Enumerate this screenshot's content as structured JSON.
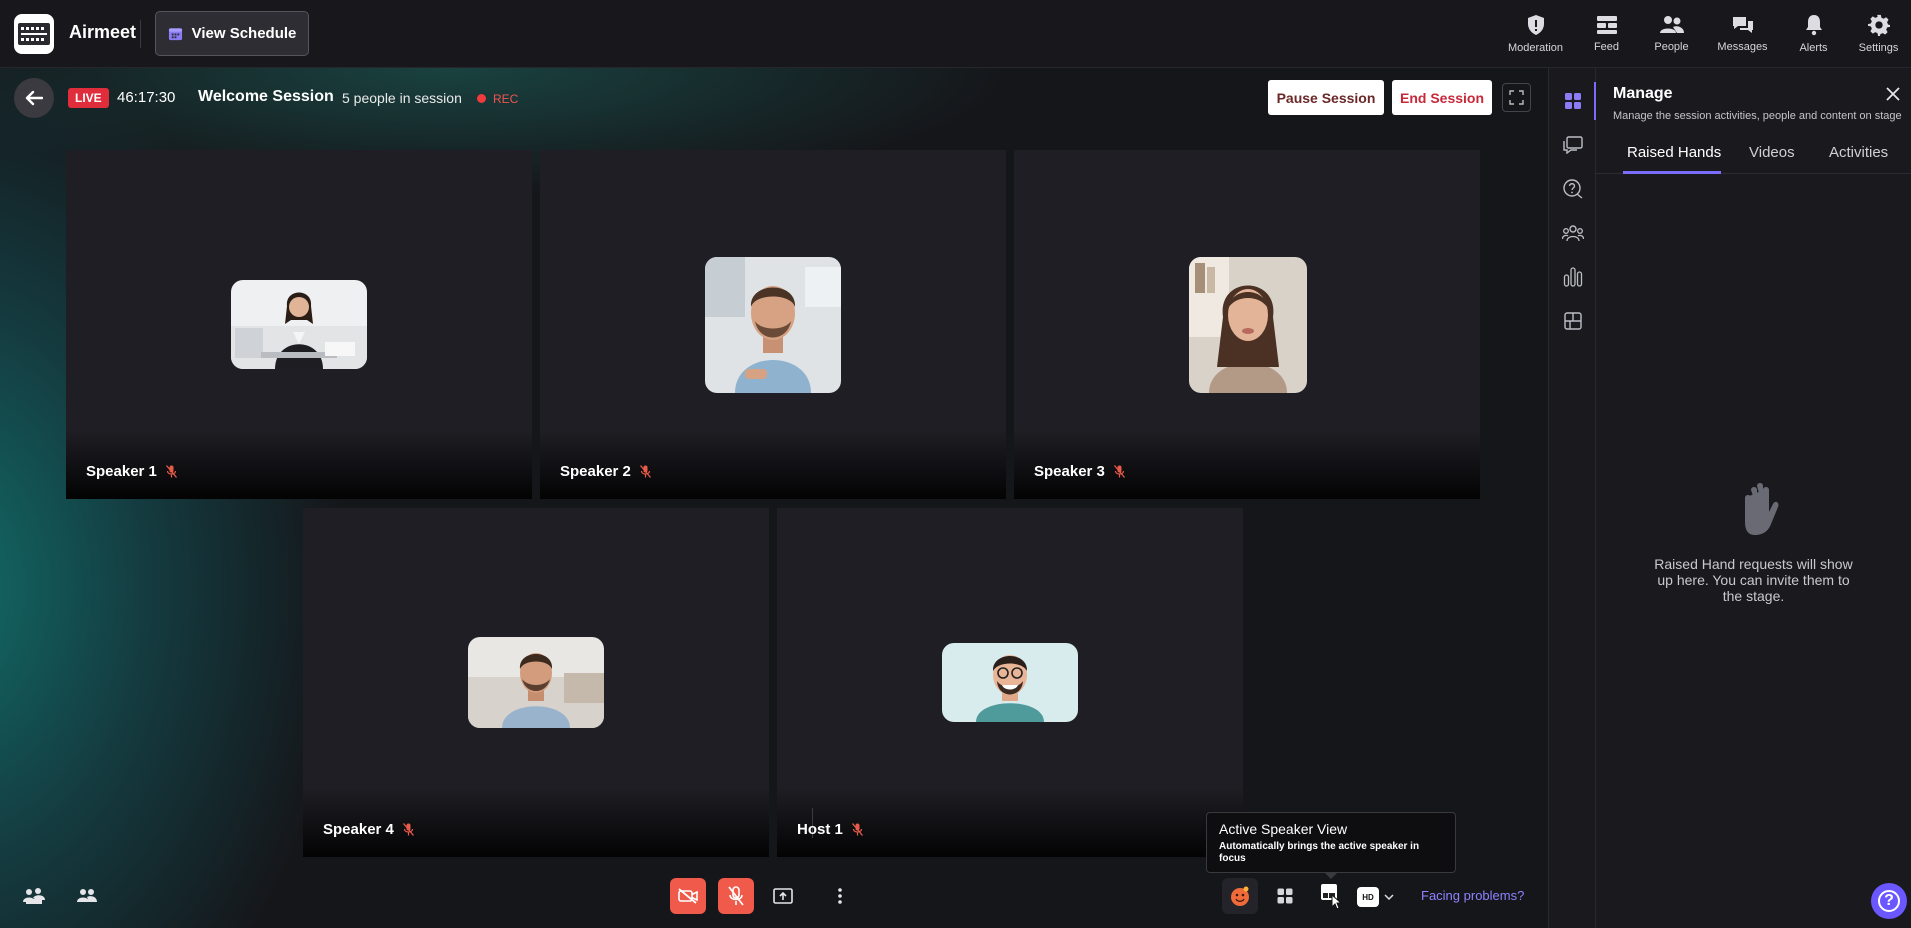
{
  "app": {
    "brand_name": "Airmeet",
    "view_schedule_label": "View Schedule"
  },
  "topnav": [
    {
      "label": "Moderation",
      "icon": "shield-alert-icon"
    },
    {
      "label": "Feed",
      "icon": "feed-icon"
    },
    {
      "label": "People",
      "icon": "people-icon"
    },
    {
      "label": "Messages",
      "icon": "messages-icon"
    },
    {
      "label": "Alerts",
      "icon": "bell-icon"
    },
    {
      "label": "Settings",
      "icon": "gear-icon"
    }
  ],
  "session": {
    "live_label": "LIVE",
    "timer": "46:17:30",
    "title": "Welcome Session",
    "people_count": "5 people in session",
    "rec_label": "REC",
    "pause_label": "Pause Session",
    "end_label": "End Session"
  },
  "speakers": [
    {
      "name": "Speaker 1",
      "muted": true
    },
    {
      "name": "Speaker 2",
      "muted": true
    },
    {
      "name": "Speaker 3",
      "muted": true
    },
    {
      "name": "Speaker 4",
      "muted": true
    },
    {
      "name": "Host 1",
      "muted": true
    }
  ],
  "tooltip": {
    "title": "Active Speaker View",
    "description": "Automatically brings the active speaker in focus"
  },
  "controls": {
    "quality_badge": "HD",
    "facing_problems": "Facing problems?"
  },
  "panel": {
    "title": "Manage",
    "subtitle": "Manage the session activities, people and content on stage",
    "tabs": [
      "Raised Hands",
      "Videos",
      "Activities"
    ],
    "active_tab": "Raised Hands",
    "empty_message": "Raised Hand requests will show up here. You can invite them to the stage."
  },
  "colors": {
    "accent": "#7a6cff",
    "live": "#e02d3c",
    "control_red": "#ef5a4a",
    "link": "#8d82ff"
  }
}
